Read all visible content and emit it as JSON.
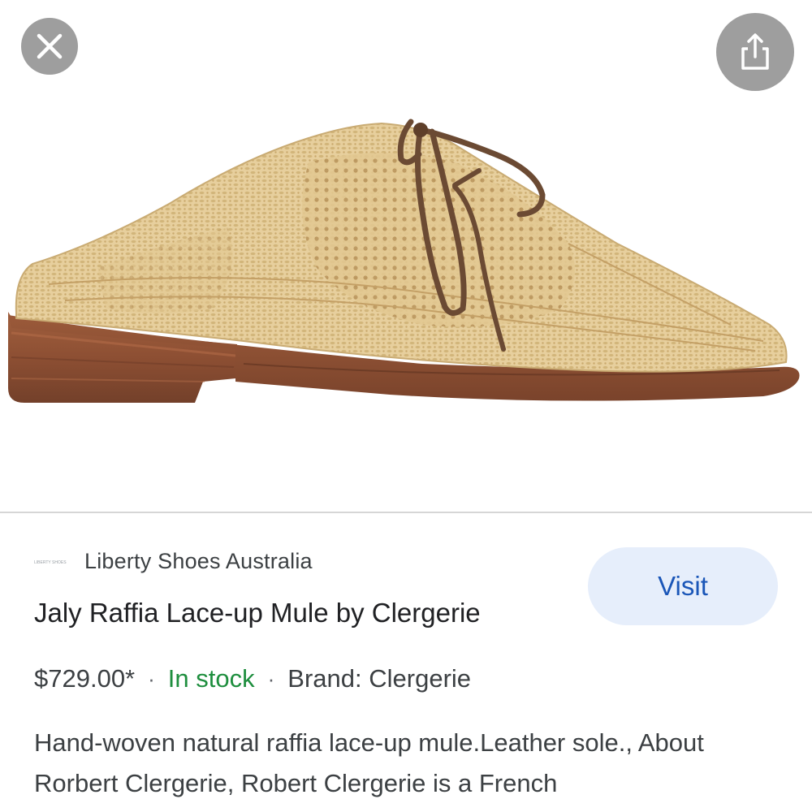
{
  "image": {
    "alt": "Jaly Raffia Lace-up Mule by Clergerie"
  },
  "controls": {
    "close_icon": "close-icon",
    "share_icon": "share-icon"
  },
  "merchant": {
    "logo_text": "LIBERTY SHOES",
    "name": "Liberty Shoes Australia"
  },
  "product": {
    "title": "Jaly Raffia Lace-up Mule by Clergerie",
    "price": "$729.00*",
    "stock": "In stock",
    "brand": "Brand: Clergerie",
    "description": "Hand-woven natural raffia lace-up mule.Leather sole., About Rorbert Clergerie, Robert Clergerie is a French"
  },
  "actions": {
    "visit_label": "Visit"
  },
  "separators": {
    "dot": "·"
  },
  "colors": {
    "stock_green": "#1e8e3e",
    "visit_text": "#1a56b8",
    "visit_bg": "#e6eefb",
    "button_gray": "#9e9e9e"
  }
}
